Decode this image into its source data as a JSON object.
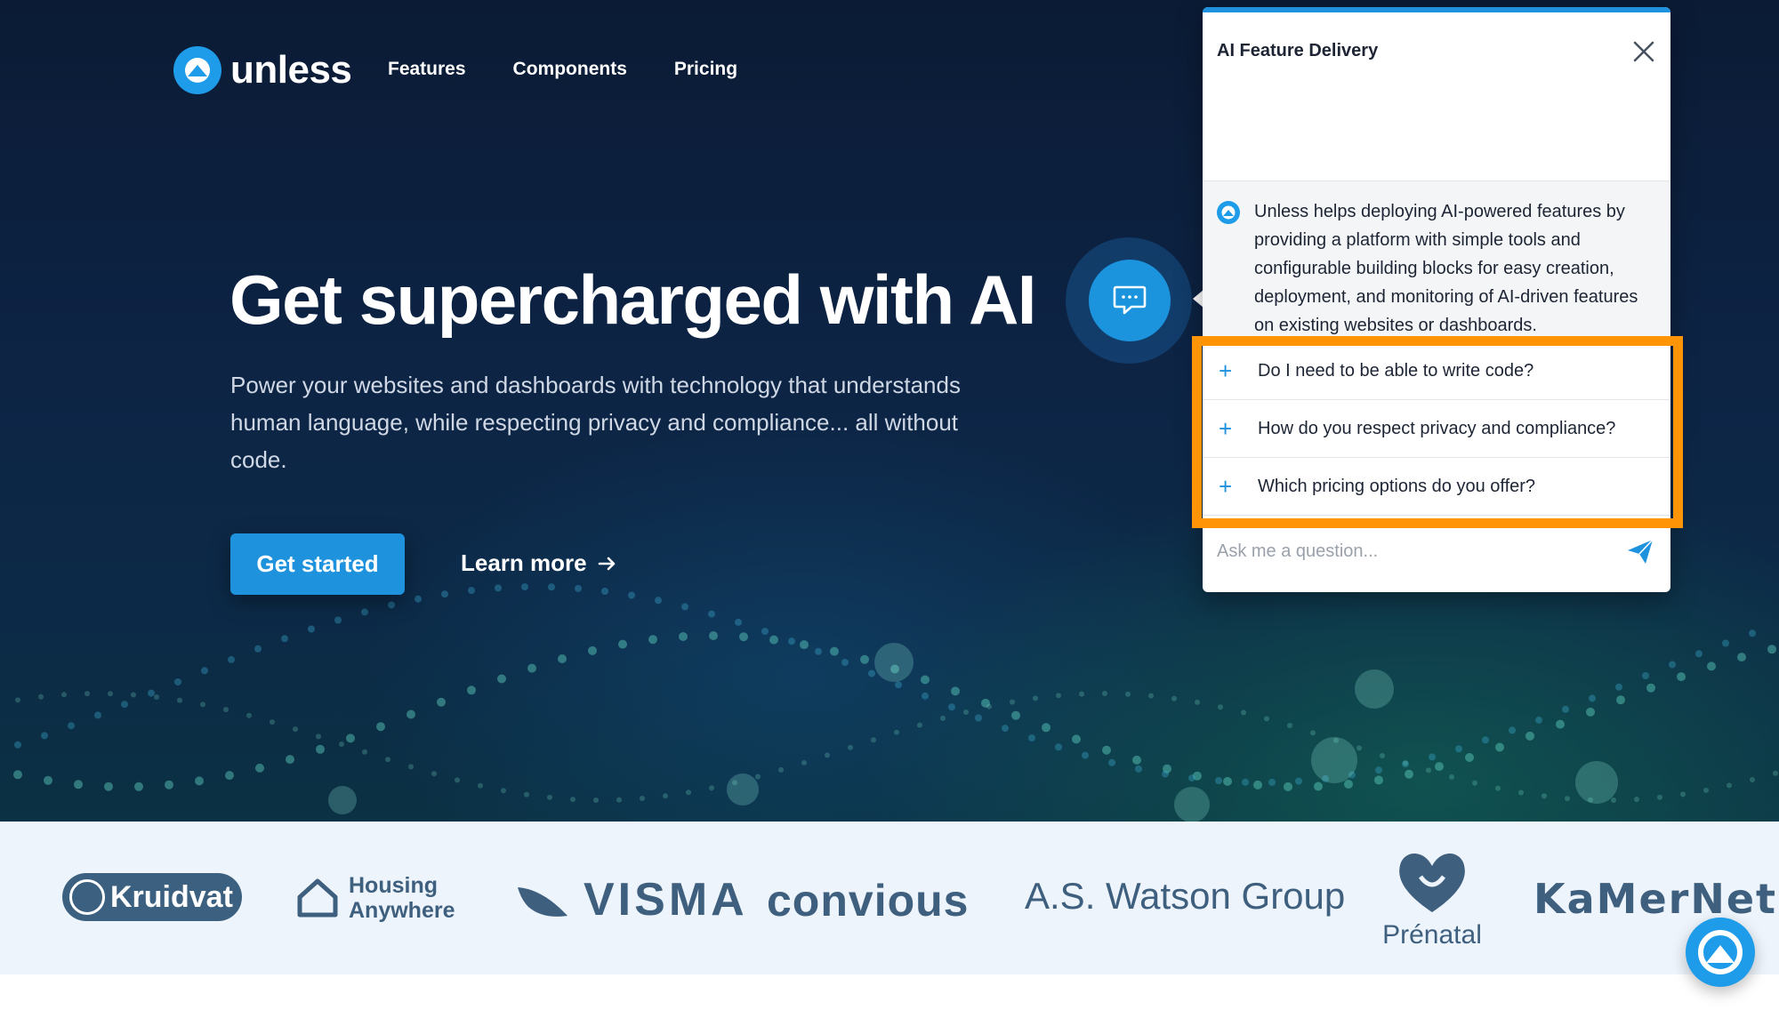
{
  "brand": {
    "name": "unless",
    "logo_icon": "unless-logo-icon",
    "accent": "#1f92de"
  },
  "nav": {
    "items": [
      "Features",
      "Components",
      "Pricing"
    ]
  },
  "hero": {
    "title": "Get supercharged with AI",
    "subtitle": "Power your websites and dashboards with technology that understands human language, while respecting privacy and compliance... all without code.",
    "cta_primary": "Get started",
    "cta_secondary": "Learn more",
    "cta_secondary_icon": "arrow-right-icon"
  },
  "chat": {
    "bubble_icon": "chat-bubble-icon",
    "panel_title": "AI Feature Delivery",
    "close_icon": "close-icon",
    "answer": "Unless helps deploying AI-powered features by providing a platform with simple tools and configurable building blocks for easy creation, deployment, and monitoring of AI-driven features on existing websites or dashboards.",
    "faq": [
      "Do I need to be able to write code?",
      "How do you respect privacy and compliance?",
      "Which pricing options do you offer?"
    ],
    "input_placeholder": "Ask me a question...",
    "send_icon": "send-icon",
    "highlight_color": "#ff9406"
  },
  "logos": {
    "kruidvat": "Kruidvat",
    "housing_line1": "Housing",
    "housing_line2": "Anywhere",
    "visma": "VISMA",
    "convious": "convious",
    "watson": "A.S. Watson Group",
    "prenatal": "Prénatal",
    "kamernet": "KaMerNet"
  }
}
